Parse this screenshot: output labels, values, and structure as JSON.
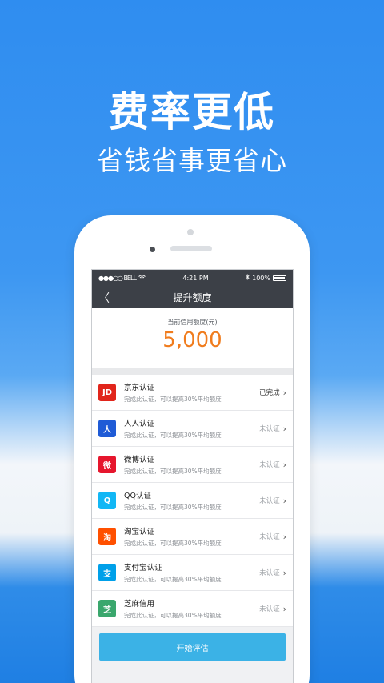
{
  "promo": {
    "headline": "费率更低",
    "subline": "省钱省事更省心"
  },
  "statusbar": {
    "carrier": "●●●○○ BELL",
    "time": "4:21 PM",
    "battery": "100%"
  },
  "navbar": {
    "back_label": "〈",
    "title": "提升额度"
  },
  "credit": {
    "label": "当前信用额度(元)",
    "value": "5,000"
  },
  "items": [
    {
      "icon_text": "JD",
      "icon_color": "#e1251b",
      "title": "京东认证",
      "desc": "完成此认证，可以提高30%平均额度",
      "status": "已完成",
      "done": true
    },
    {
      "icon_text": "人",
      "icon_color": "#1f5bd6",
      "title": "人人认证",
      "desc": "完成此认证，可以提高30%平均额度",
      "status": "未认证",
      "done": false
    },
    {
      "icon_text": "微",
      "icon_color": "#e6162d",
      "title": "微博认证",
      "desc": "完成此认证，可以提高30%平均额度",
      "status": "未认证",
      "done": false
    },
    {
      "icon_text": "Q",
      "icon_color": "#12b7f5",
      "title": "QQ认证",
      "desc": "完成此认证，可以提高30%平均额度",
      "status": "未认证",
      "done": false
    },
    {
      "icon_text": "淘",
      "icon_color": "#ff5000",
      "title": "淘宝认证",
      "desc": "完成此认证，可以提高30%平均额度",
      "status": "未认证",
      "done": false
    },
    {
      "icon_text": "支",
      "icon_color": "#00a0e9",
      "title": "支付宝认证",
      "desc": "完成此认证，可以提高30%平均额度",
      "status": "未认证",
      "done": false
    },
    {
      "icon_text": "芝",
      "icon_color": "#3aa76d",
      "title": "芝麻信用",
      "desc": "完成此认证，可以提高30%平均额度",
      "status": "未认证",
      "done": false
    }
  ],
  "chevron": "›",
  "actions": {
    "start_label": "开始评估"
  }
}
